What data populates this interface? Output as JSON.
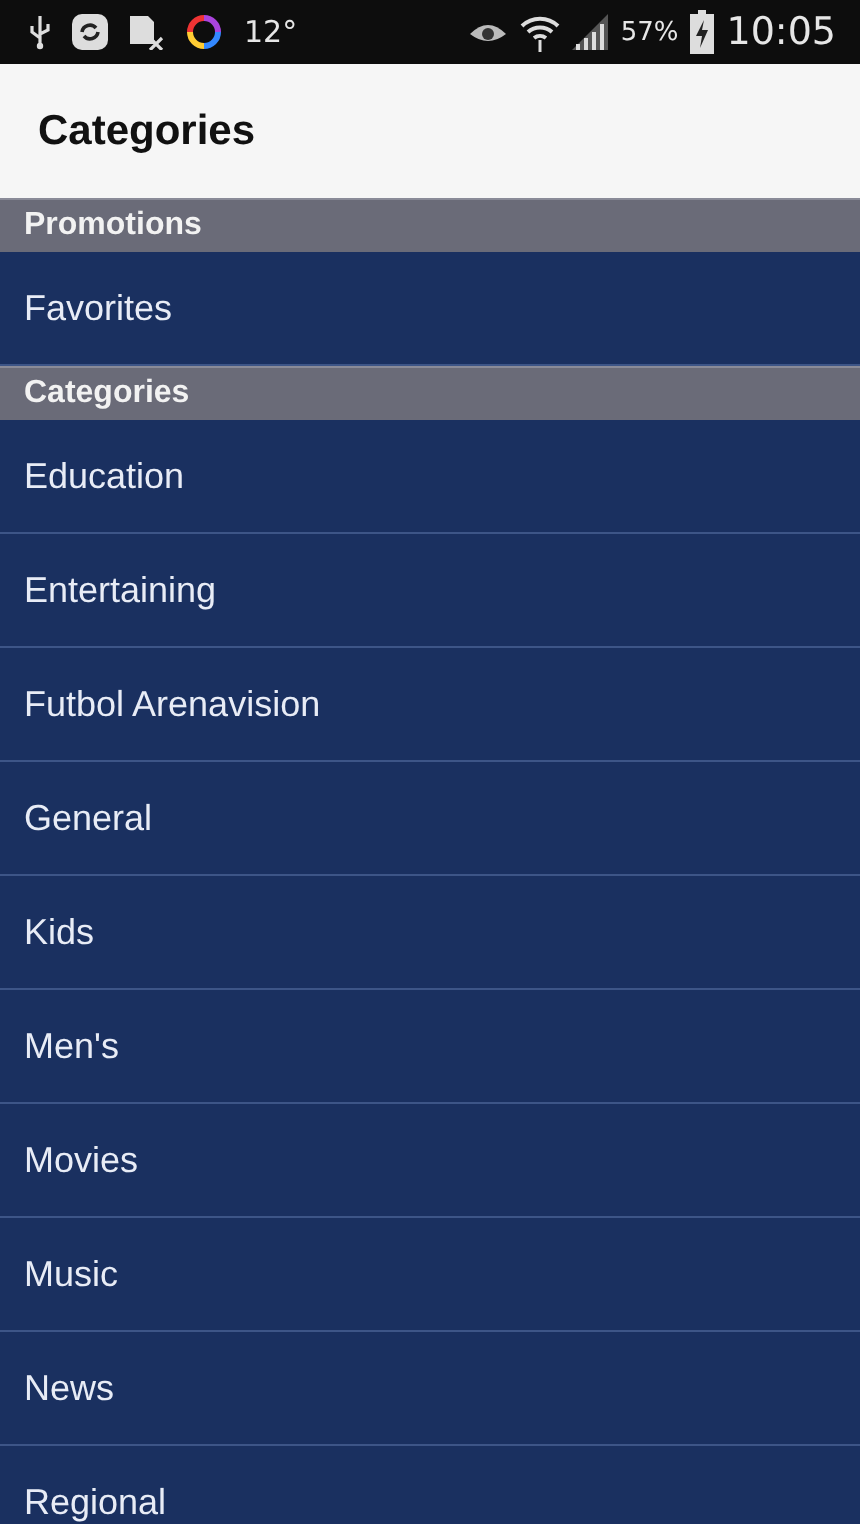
{
  "status_bar": {
    "temperature": "12°",
    "battery": "57%",
    "time": "10:05"
  },
  "app_bar": {
    "title": "Categories"
  },
  "sections": [
    {
      "title": "Promotions",
      "items": [
        "Favorites"
      ]
    },
    {
      "title": "Categories",
      "items": [
        "Education",
        "Entertaining",
        "Futbol Arenavision",
        "General",
        "Kids",
        "Men's",
        "Movies",
        "Music",
        "News",
        "Regional"
      ]
    }
  ]
}
